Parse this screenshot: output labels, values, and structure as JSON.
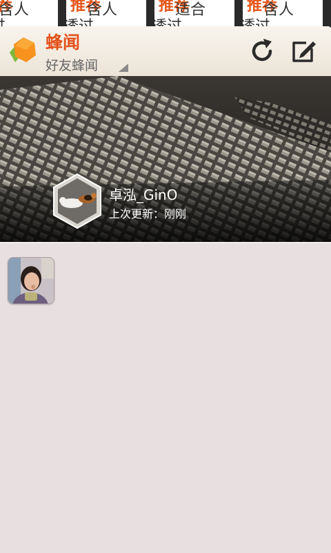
{
  "background_cards": [
    {
      "orange": "推荐",
      "line1": "含人",
      "line2": "透过"
    },
    {
      "orange": "推荐",
      "line1": "含人",
      "line2": "透过"
    },
    {
      "orange": "推荐",
      "line1": "适合",
      "line2": "透过"
    },
    {
      "orange": "推荐",
      "line1": "含人",
      "line2": "透过"
    }
  ],
  "header": {
    "title": "蜂闻",
    "subtitle": "好友蜂闻",
    "refresh_icon": "refresh-icon",
    "compose_icon": "compose-icon"
  },
  "banner": {
    "user_name": "卓泓_GinO",
    "last_update": "上次更新：刚刚"
  },
  "colors": {
    "accent": "#e3501a",
    "background": "#e7dfe0",
    "header_bg": "#f4efe6"
  }
}
